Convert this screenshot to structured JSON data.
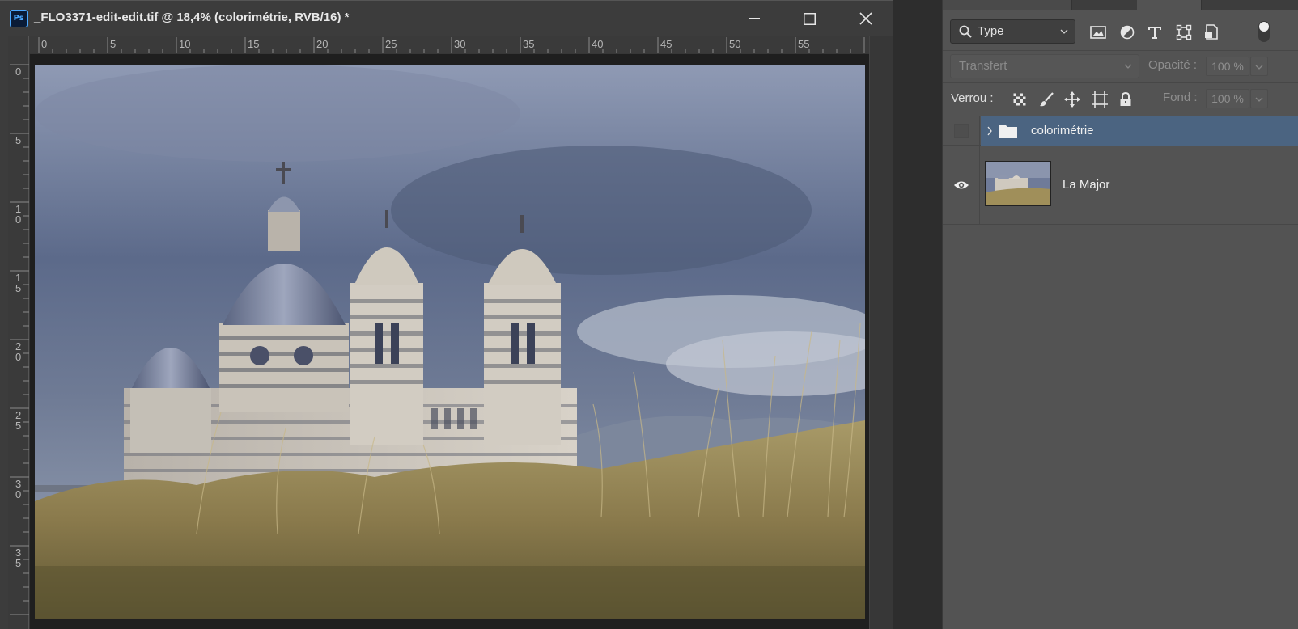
{
  "document": {
    "app_badge": "Ps",
    "title": "_FLO3371-edit-edit.tif @ 18,4% (colorimétrie, RVB/16) *",
    "ruler_h_labels": [
      "0",
      "5",
      "10",
      "15",
      "20",
      "25",
      "30",
      "35",
      "40",
      "45",
      "50",
      "55"
    ],
    "ruler_v_labels": [
      "0",
      "5",
      "10",
      "15",
      "20",
      "25",
      "30",
      "35"
    ]
  },
  "window_controls": {
    "minimize": "minimize-icon",
    "maximize": "maximize-icon",
    "close": "close-icon"
  },
  "layers_panel": {
    "filter_label": "Type",
    "filter_icons": [
      "image-filter-icon",
      "adjustment-filter-icon",
      "type-filter-icon",
      "shape-filter-icon",
      "smart-object-filter-icon"
    ],
    "blend_mode": "Transfert",
    "opacity_label": "Opacité :",
    "opacity_value": "100 %",
    "lock_label": "Verrou :",
    "lock_icons": [
      "lock-transparency-icon",
      "lock-pixels-icon",
      "lock-position-icon",
      "lock-artboard-icon",
      "lock-all-icon"
    ],
    "fill_label": "Fond :",
    "fill_value": "100 %",
    "layers": [
      {
        "name": "colorimétrie",
        "kind": "group",
        "visible": false,
        "selected": true
      },
      {
        "name": "La Major",
        "kind": "pixel",
        "visible": true,
        "selected": false
      }
    ]
  },
  "colors": {
    "selection": "#4b6481",
    "panel_bg": "#535353",
    "ps_blue": "#4aa8ff"
  }
}
